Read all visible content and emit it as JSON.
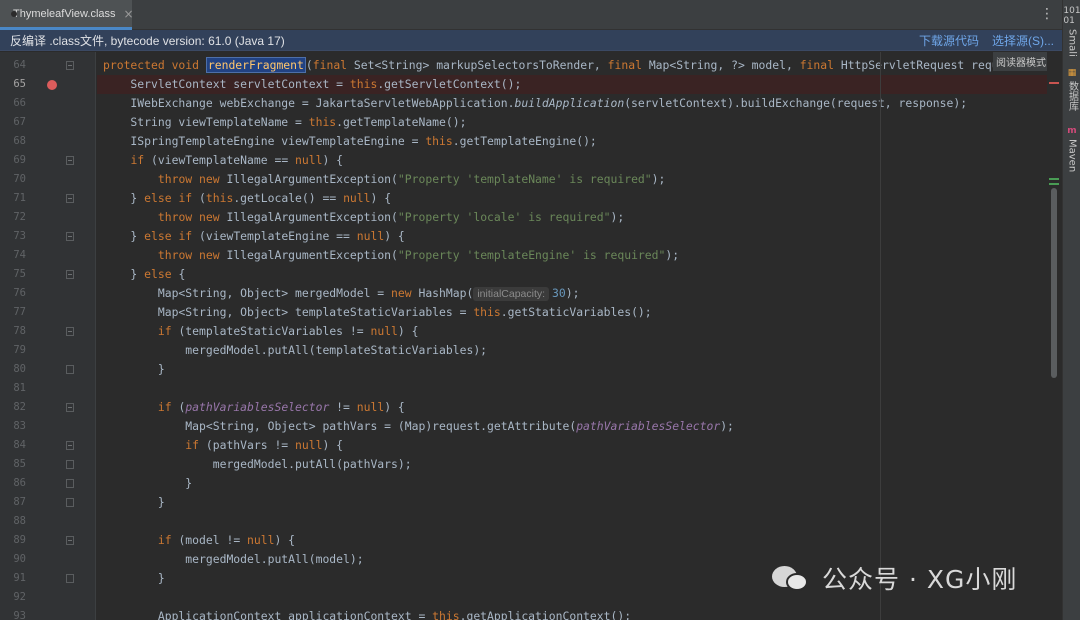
{
  "tab": {
    "label": "ThymeleafView.class",
    "close": "×",
    "menu_icon": "vertical-dots-icon"
  },
  "banner": {
    "text": "反编译 .class文件, bytecode version: 61.0 (Java 17)",
    "download_source": "下载源代码",
    "choose_source": "选择源(S)..."
  },
  "reader_mode": "阅读器模式",
  "right_tools": [
    {
      "icon": "101\n01",
      "label": "Smali"
    },
    {
      "icon": "db-icon",
      "label": "数据库"
    },
    {
      "icon": "maven-icon",
      "label": "Maven"
    }
  ],
  "watermark": "公众号 · XG小刚",
  "code_lines": [
    {
      "n": "64",
      "html": "<span class=\"k\">protected void </span><span class=\"sel\">renderFragment</span>(<span class=\"k\">final </span>Set&lt;String&gt; markupSelectorsToRender, <span class=\"k\">final </span>Map&lt;String, ?&gt; model, <span class=\"k\">final </span>HttpServletRequest reque"
    },
    {
      "n": "65",
      "html": "    ServletContext servletContext = <span class=\"k\">this</span>.getServletContext();"
    },
    {
      "n": "66",
      "html": "    IWebExchange webExchange = JakartaServletWebApplication.<span class=\"i\">buildApplication</span>(servletContext).buildExchange(request, response);"
    },
    {
      "n": "67",
      "html": "    String viewTemplateName = <span class=\"k\">this</span>.getTemplateName();"
    },
    {
      "n": "68",
      "html": "    ISpringTemplateEngine viewTemplateEngine = <span class=\"k\">this</span>.getTemplateEngine();"
    },
    {
      "n": "69",
      "html": "    <span class=\"k\">if </span>(viewTemplateName == <span class=\"k\">null</span>) {"
    },
    {
      "n": "70",
      "html": "        <span class=\"k\">throw new </span>IllegalArgumentException(<span class=\"s\">\"Property 'templateName' is required\"</span>);"
    },
    {
      "n": "71",
      "html": "    } <span class=\"k\">else if </span>(<span class=\"k\">this</span>.getLocale() == <span class=\"k\">null</span>) {"
    },
    {
      "n": "72",
      "html": "        <span class=\"k\">throw new </span>IllegalArgumentException(<span class=\"s\">\"Property 'locale' is required\"</span>);"
    },
    {
      "n": "73",
      "html": "    } <span class=\"k\">else if </span>(viewTemplateEngine == <span class=\"k\">null</span>) {"
    },
    {
      "n": "74",
      "html": "        <span class=\"k\">throw new </span>IllegalArgumentException(<span class=\"s\">\"Property 'templateEngine' is required\"</span>);"
    },
    {
      "n": "75",
      "html": "    } <span class=\"k\">else </span>{"
    },
    {
      "n": "76",
      "html": "        Map&lt;String, Object&gt; mergedModel = <span class=\"k\">new </span>HashMap(<span class=\"hint\">initialCapacity:</span><span class=\"n\">30</span>);"
    },
    {
      "n": "77",
      "html": "        Map&lt;String, Object&gt; templateStaticVariables = <span class=\"k\">this</span>.getStaticVariables();"
    },
    {
      "n": "78",
      "html": "        <span class=\"k\">if </span>(templateStaticVariables != <span class=\"k\">null</span>) {"
    },
    {
      "n": "79",
      "html": "            mergedModel.putAll(templateStaticVariables);"
    },
    {
      "n": "80",
      "html": "        }"
    },
    {
      "n": "81",
      "html": ""
    },
    {
      "n": "82",
      "html": "        <span class=\"k\">if </span>(<span class=\"f\">pathVariablesSelector</span> != <span class=\"k\">null</span>) {"
    },
    {
      "n": "83",
      "html": "            Map&lt;String, Object&gt; pathVars = (Map)request.getAttribute(<span class=\"f\">pathVariablesSelector</span>);"
    },
    {
      "n": "84",
      "html": "            <span class=\"k\">if </span>(pathVars != <span class=\"k\">null</span>) {"
    },
    {
      "n": "85",
      "html": "                mergedModel.putAll(pathVars);"
    },
    {
      "n": "86",
      "html": "            }"
    },
    {
      "n": "87",
      "html": "        }"
    },
    {
      "n": "88",
      "html": ""
    },
    {
      "n": "89",
      "html": "        <span class=\"k\">if </span>(model != <span class=\"k\">null</span>) {"
    },
    {
      "n": "90",
      "html": "            mergedModel.putAll(model);"
    },
    {
      "n": "91",
      "html": "        }"
    },
    {
      "n": "92",
      "html": ""
    },
    {
      "n": "93",
      "html": "        ApplicationContext applicationContext = <span class=\"k\">this</span>.getApplicationContext();"
    }
  ]
}
